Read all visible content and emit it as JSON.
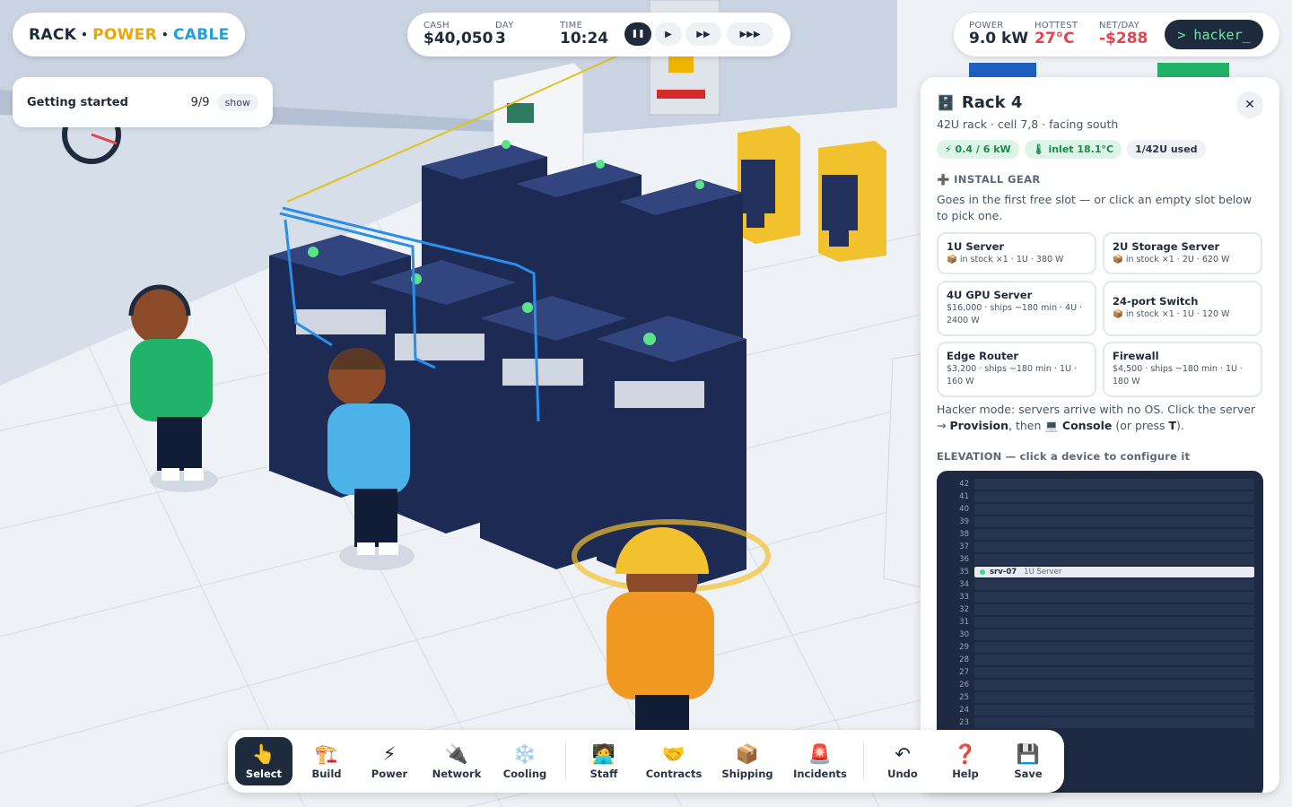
{
  "brand": {
    "rack": "RACK",
    "power": "POWER",
    "cable": "CABLE",
    "sep": "•"
  },
  "getting_started": {
    "title": "Getting started",
    "progress": "9/9",
    "toggle": "show"
  },
  "timebar": {
    "cash_label": "CASH",
    "cash": "$40,050",
    "day_label": "DAY",
    "day": "3",
    "time_label": "TIME",
    "time": "10:24",
    "speeds": [
      {
        "icon": "pause-icon",
        "glyph": "❚❚",
        "active": true
      },
      {
        "icon": "play-icon",
        "glyph": "▶",
        "active": false
      },
      {
        "icon": "fast-forward-icon",
        "glyph": "▶▶",
        "active": false
      },
      {
        "icon": "fastest-forward-icon",
        "glyph": "▶▶▶",
        "active": false
      }
    ]
  },
  "status": {
    "power_label": "POWER",
    "power": "9.0 kW",
    "hottest_label": "HOTTEST",
    "hottest": "27°C",
    "net_label": "NET/DAY",
    "net": "-$288",
    "hacker": "> hacker_"
  },
  "panel": {
    "icon": "🗄️",
    "title": "Rack 4",
    "close": "✕",
    "subtitle": "42U rack · cell 7,8 · facing south",
    "chips": [
      {
        "text": "⚡ 0.4 / 6 kW",
        "style": "green"
      },
      {
        "text": "🌡 inlet 18.1°C",
        "style": "green"
      },
      {
        "text": "1/42U used",
        "style": "gray"
      }
    ],
    "install_heading": "➕ INSTALL GEAR",
    "install_desc": "Goes in the first free slot — or click an empty slot below to pick one.",
    "gear": [
      {
        "name": "1U Server",
        "detail": "📦 in stock ×1 · 1U · 380 W"
      },
      {
        "name": "2U Storage Server",
        "detail": "📦 in stock ×1 · 2U · 620 W"
      },
      {
        "name": "4U GPU Server",
        "detail": "$16,000 · ships ~180 min · 4U · 2400 W"
      },
      {
        "name": "24-port Switch",
        "detail": "📦 in stock ×1 · 1U · 120 W"
      },
      {
        "name": "Edge Router",
        "detail": "$3,200 · ships ~180 min · 1U · 160 W"
      },
      {
        "name": "Firewall",
        "detail": "$4,500 · ships ~180 min · 1U · 180 W"
      }
    ],
    "hacker_note_1": "Hacker mode: servers arrive with no OS. Click the server → ",
    "hacker_note_provision": "Provision",
    "hacker_note_2": ", then 💻 ",
    "hacker_note_console": "Console",
    "hacker_note_3": " (or press ",
    "hacker_note_key": "T",
    "hacker_note_4": ").",
    "elevation_heading": "ELEVATION — click a device to configure it",
    "elevation_units": [
      "42",
      "41",
      "40",
      "39",
      "38",
      "37",
      "36",
      "35",
      "34",
      "33",
      "32",
      "31",
      "30",
      "29",
      "28",
      "27",
      "26",
      "25",
      "24",
      "23"
    ],
    "device": {
      "unit": "35",
      "name": "srv-07",
      "type": "1U Server"
    }
  },
  "toolbar": {
    "tools": [
      {
        "id": "select",
        "icon": "👆",
        "label": "Select",
        "active": true
      },
      {
        "id": "build",
        "icon": "🏗️",
        "label": "Build",
        "active": false
      },
      {
        "id": "power",
        "icon": "⚡",
        "label": "Power",
        "active": false
      },
      {
        "id": "network",
        "icon": "🔌",
        "label": "Network",
        "active": false
      },
      {
        "id": "cooling",
        "icon": "❄️",
        "label": "Cooling",
        "active": false
      },
      {
        "id": "staff",
        "icon": "🧑‍💻",
        "label": "Staff",
        "active": false
      },
      {
        "id": "contracts",
        "icon": "🤝",
        "label": "Contracts",
        "active": false
      },
      {
        "id": "shipping",
        "icon": "📦",
        "label": "Shipping",
        "active": false
      },
      {
        "id": "incidents",
        "icon": "🚨",
        "label": "Incidents",
        "active": false
      },
      {
        "id": "undo",
        "icon": "↶",
        "label": "Undo",
        "active": false
      },
      {
        "id": "help",
        "icon": "❓",
        "label": "Help",
        "active": false
      },
      {
        "id": "save",
        "icon": "💾",
        "label": "Save",
        "active": false
      }
    ]
  },
  "colors": {
    "accent_dark": "#1e2b3d",
    "power_orange": "#f0a500",
    "cable_blue": "#1ba0e2",
    "hot_red": "#e8424d",
    "terminal_green": "#6ee7a8",
    "rack_navy": "#23315f"
  }
}
